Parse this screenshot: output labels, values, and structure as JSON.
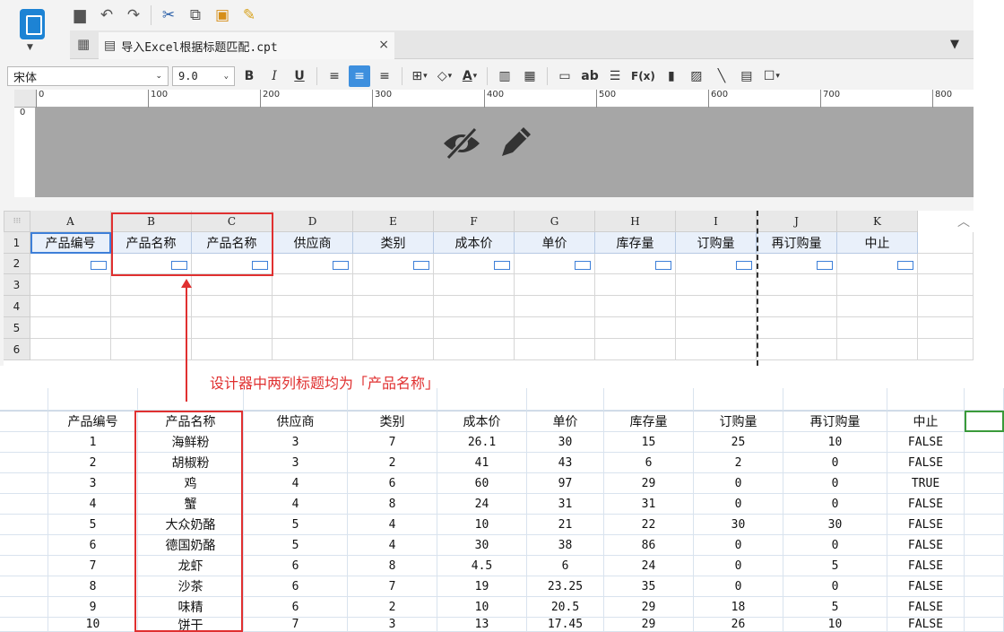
{
  "file_tab": {
    "name": "导入Excel根据标题匹配.cpt",
    "close": "×"
  },
  "toolbar": {
    "font_family": "宋体",
    "font_size": "9.0",
    "bold": "B",
    "italic": "I",
    "underline": "U",
    "text_ab": "ab",
    "formula": "F(x)",
    "font_color_letter": "A"
  },
  "ruler": {
    "ticks": [
      "0",
      "100",
      "200",
      "300",
      "400",
      "500",
      "600",
      "700",
      "800"
    ],
    "vertical_zero": "0"
  },
  "designer_sheet": {
    "columns": [
      "A",
      "B",
      "C",
      "D",
      "E",
      "F",
      "G",
      "H",
      "I",
      "J",
      "K"
    ],
    "rows": [
      "1",
      "2",
      "3",
      "4",
      "5",
      "6"
    ],
    "titles": [
      "产品编号",
      "产品名称",
      "产品名称",
      "供应商",
      "类别",
      "成本价",
      "单价",
      "库存量",
      "订购量",
      "再订购量",
      "中止"
    ]
  },
  "annotation": "设计器中两列标题均为「产品名称」",
  "excel": {
    "headers": [
      "产品编号",
      "产品名称",
      "供应商",
      "类别",
      "成本价",
      "单价",
      "库存量",
      "订购量",
      "再订购量",
      "中止"
    ],
    "rows": [
      [
        "1",
        "海鲜粉",
        "3",
        "7",
        "26.1",
        "30",
        "15",
        "25",
        "10",
        "FALSE"
      ],
      [
        "2",
        "胡椒粉",
        "3",
        "2",
        "41",
        "43",
        "6",
        "2",
        "0",
        "FALSE"
      ],
      [
        "3",
        "鸡",
        "4",
        "6",
        "60",
        "97",
        "29",
        "0",
        "0",
        "TRUE"
      ],
      [
        "4",
        "蟹",
        "4",
        "8",
        "24",
        "31",
        "31",
        "0",
        "0",
        "FALSE"
      ],
      [
        "5",
        "大众奶酪",
        "5",
        "4",
        "10",
        "21",
        "22",
        "30",
        "30",
        "FALSE"
      ],
      [
        "6",
        "德国奶酪",
        "5",
        "4",
        "30",
        "38",
        "86",
        "0",
        "0",
        "FALSE"
      ],
      [
        "7",
        "龙虾",
        "6",
        "8",
        "4.5",
        "6",
        "24",
        "0",
        "5",
        "FALSE"
      ],
      [
        "8",
        "沙茶",
        "6",
        "7",
        "19",
        "23.25",
        "35",
        "0",
        "0",
        "FALSE"
      ],
      [
        "9",
        "味精",
        "6",
        "2",
        "10",
        "20.5",
        "29",
        "18",
        "5",
        "FALSE"
      ],
      [
        "10",
        "饼干",
        "7",
        "3",
        "13",
        "17.45",
        "29",
        "26",
        "10",
        "FALSE"
      ]
    ]
  },
  "colors": {
    "accent": "#3d8fde",
    "annotation": "#e03030",
    "header_band": "#a6a6a6"
  }
}
